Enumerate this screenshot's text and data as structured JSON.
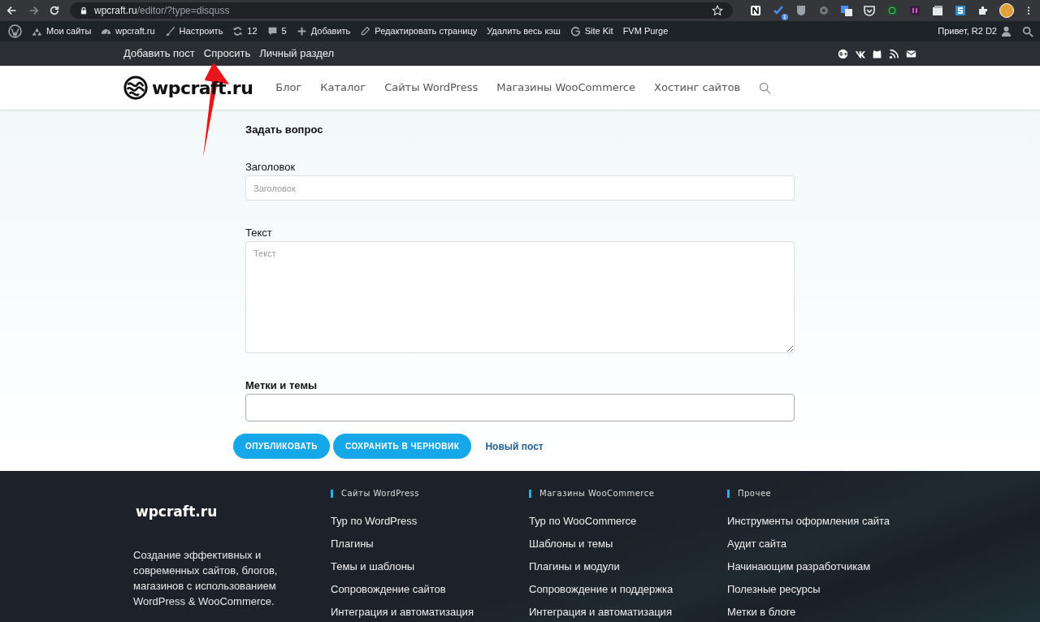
{
  "browser": {
    "url_host": "wpcraft.ru",
    "url_path": "/editor/?type=disquss",
    "extension_badge": "1"
  },
  "admin_bar": {
    "items": [
      {
        "kind": "logo"
      },
      {
        "kind": "sites",
        "label": "Мои сайты"
      },
      {
        "kind": "site",
        "label": "wpcraft.ru"
      },
      {
        "kind": "customize",
        "label": "Настроить"
      },
      {
        "kind": "updates",
        "label": "12"
      },
      {
        "kind": "comments",
        "label": "5"
      },
      {
        "kind": "new",
        "label": "Добавить"
      },
      {
        "kind": "edit",
        "label": "Редактировать страницу"
      },
      {
        "kind": "plain",
        "label": "Удалить весь кэш"
      },
      {
        "kind": "google",
        "label": "Site Kit"
      },
      {
        "kind": "plain",
        "label": "FVM Purge"
      }
    ],
    "greeting": "Привет, R2 D2"
  },
  "top_nav": [
    "Добавить пост",
    "Спросить",
    "Личный раздел"
  ],
  "header": {
    "logo": "wpcraft.ru",
    "nav": [
      "Блог",
      "Каталог",
      "Сайты WordPress",
      "Магазины WooCommerce",
      "Хостинг сайтов"
    ]
  },
  "form": {
    "title": "Задать вопрос",
    "fields": [
      {
        "kind": "input",
        "label": "Заголовок",
        "label_bold": false,
        "placeholder": "Заголовок"
      },
      {
        "kind": "textarea",
        "label": "Текст",
        "label_bold": false,
        "placeholder": "Текст"
      },
      {
        "kind": "input",
        "label": "Метки и темы",
        "label_bold": true
      }
    ],
    "buttons": [
      "ОПУБЛИКОВАТЬ",
      "СОХРАНИТЬ В ЧЕРНОВИК"
    ],
    "link": "Новый пост"
  },
  "footer": {
    "brand": "wpcraft.ru",
    "description": "Создание эффективных и современных сайтов, блогов, магазинов с использованием WordPress & WooCommerce.",
    "columns": [
      {
        "title": "Сайты WordPress",
        "links": [
          "Тур по WordPress",
          "Плагины",
          "Темы и шаблоны",
          "Сопровождение сайтов",
          "Интеграция и автоматизация"
        ]
      },
      {
        "title": "Магазины WooCommerce",
        "links": [
          "Тур по WooCommerce",
          "Шаблоны и темы",
          "Плагины и модули",
          "Сопровождение и поддержка",
          "Интеграция и автоматизация"
        ]
      },
      {
        "title": "Прочее",
        "links": [
          "Инструменты оформления сайта",
          "Аудит сайта",
          "Начинающим разработчикам",
          "Полезные ресурсы",
          "Метки в блоге"
        ]
      }
    ]
  }
}
